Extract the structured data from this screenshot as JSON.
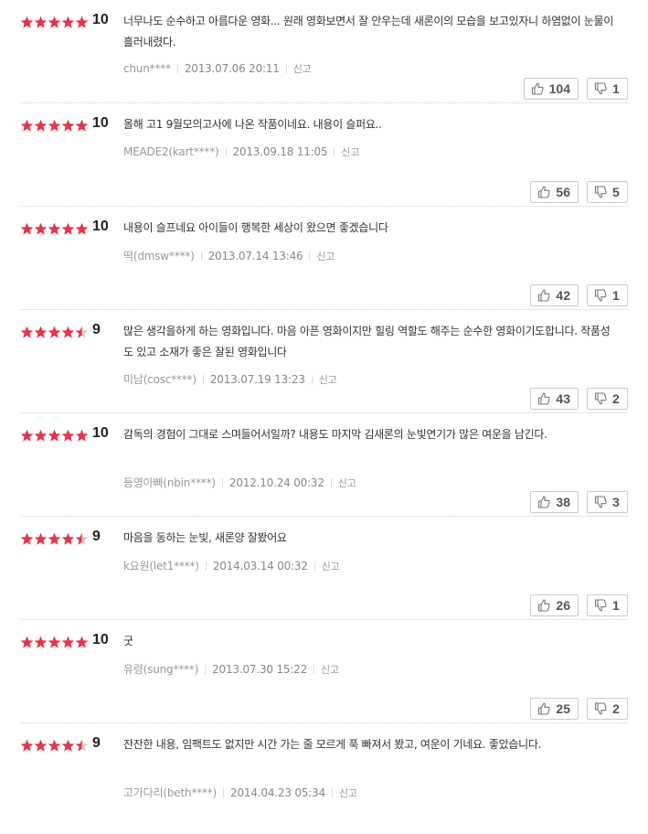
{
  "colors": {
    "star_filled": "#e6344a",
    "star_empty": "#cccccc",
    "meta": "#999999"
  },
  "labels": {
    "report": "신고"
  },
  "reviews": [
    {
      "rating_stars": 5,
      "score": "10",
      "comment": "너무나도 순수하고 아름다운 영화... 원래 영화보면서 잘 안우는데 새론이의 모습을 보고있자니 하염없이 눈물이 흘러내렸다.",
      "author": "chun****",
      "date": "2013.07.06 20:11",
      "likes": "104",
      "dislikes": "1"
    },
    {
      "rating_stars": 5,
      "score": "10",
      "comment": "올해 고1 9월모의고사에 나온 작품이네요. 내용이 슬퍼요..",
      "author": "MEADE2(kart****)",
      "date": "2013.09.18 11:05",
      "likes": "56",
      "dislikes": "5"
    },
    {
      "rating_stars": 5,
      "score": "10",
      "comment": "내용이 슬프네요 아이들이 행복한 세상이 왔으면 좋겠습니다",
      "author": "떡(dmsw****)",
      "date": "2013.07.14 13:46",
      "likes": "42",
      "dislikes": "1"
    },
    {
      "rating_stars": 4.5,
      "score": "9",
      "comment": "많은 생각을하게 하는 영화입니다. 마음 아픈 영화이지만 힐링 역할도 해주는 순수한 영화이기도합니다. 작품성도 있고 소재가 좋은 잘된 영화입니다",
      "author": "미남(cosc****)",
      "date": "2013.07.19 13:23",
      "likes": "43",
      "dislikes": "2"
    },
    {
      "rating_stars": 5,
      "score": "10",
      "comment": "감독의 경험이 그대로 스며들어서일까? 내용도 마지막 김새론의 눈빛연기가 많은 여운을 남긴다.",
      "author": "등영아빠(nbin****)",
      "date": "2012.10.24 00:32",
      "likes": "38",
      "dislikes": "3"
    },
    {
      "rating_stars": 4.5,
      "score": "9",
      "comment": "마음을 동하는 눈빛, 새론양 잘봤어요",
      "author": "k요원(let1****)",
      "date": "2014.03.14 00:32",
      "likes": "26",
      "dislikes": "1"
    },
    {
      "rating_stars": 5,
      "score": "10",
      "comment": "굿",
      "author": "유령(sung****)",
      "date": "2013.07.30 15:22",
      "likes": "25",
      "dislikes": "2"
    },
    {
      "rating_stars": 4.5,
      "score": "9",
      "comment": "잔잔한 내용, 임팩트도 없지만 시간 가는 줄 모르게 푹 빠져서 봤고, 여운이 기네요. 좋았습니다.",
      "author": "고가다리(beth****)",
      "date": "2014.04.23 05:34",
      "likes": "",
      "dislikes": ""
    }
  ]
}
